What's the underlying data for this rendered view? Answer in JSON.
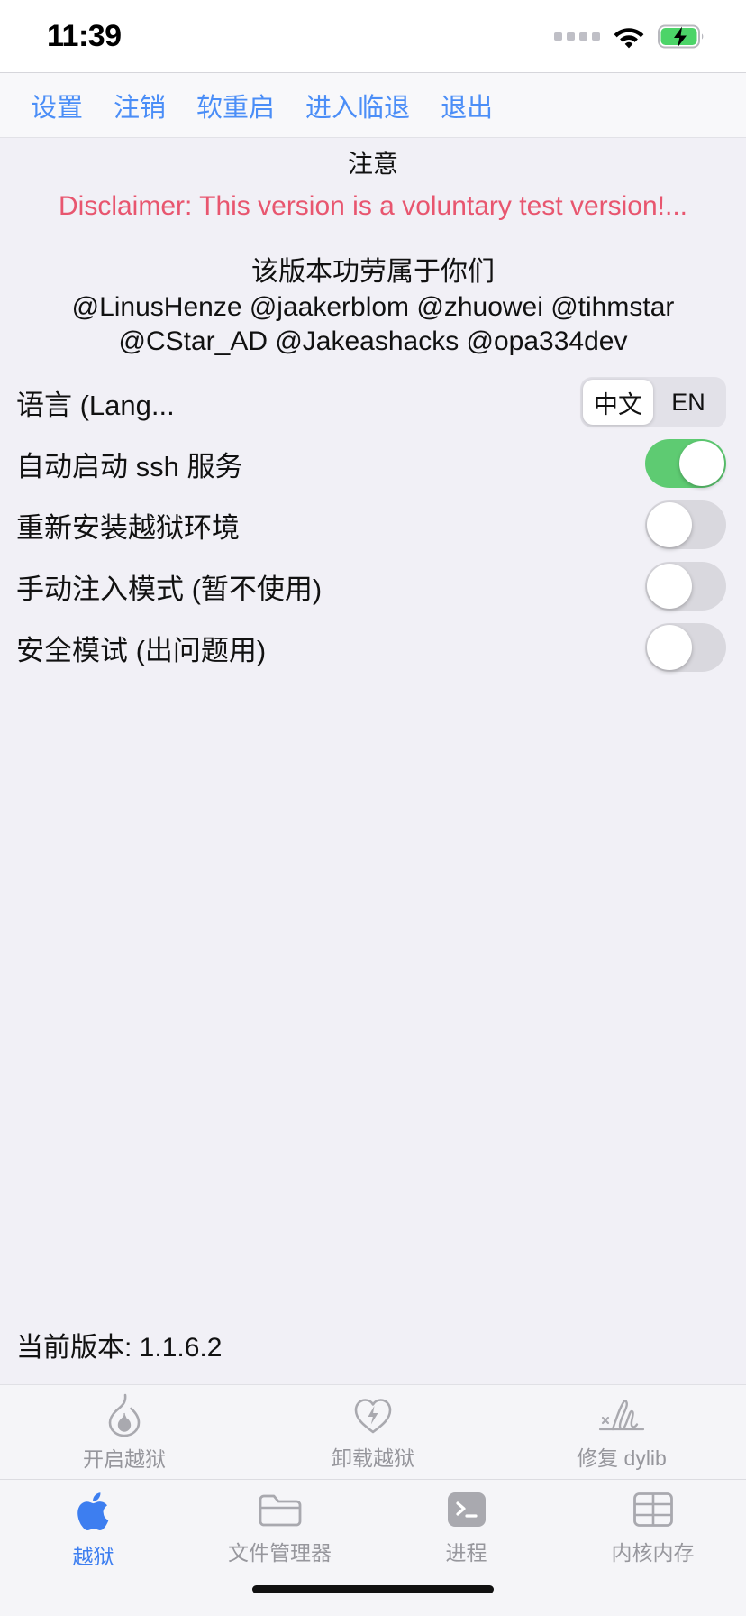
{
  "status_bar": {
    "time": "11:39",
    "signal_icon": "signal-dots-icon",
    "wifi_icon": "wifi-icon",
    "battery_icon": "battery-charging-icon"
  },
  "nav_buttons": [
    {
      "label": "设置",
      "name": "settings-button"
    },
    {
      "label": "注销",
      "name": "logout-button"
    },
    {
      "label": "软重启",
      "name": "soft-restart-button"
    },
    {
      "label": "进入临退",
      "name": "enter-temp-exit-button"
    },
    {
      "label": "退出",
      "name": "exit-button"
    }
  ],
  "notice": {
    "title": "注意",
    "disclaimer": "Disclaimer: This version is a voluntary test version!..."
  },
  "credits": {
    "title": "该版本功劳属于你们",
    "line1": "@LinusHenze @jaakerblom @zhuowei @tihmstar",
    "line2": "@CStar_AD @Jakeashacks @opa334dev"
  },
  "settings": {
    "language_row": {
      "label": "语言 (Lang...",
      "options": [
        "中文",
        "EN"
      ],
      "selected": "中文"
    },
    "toggles": [
      {
        "label": "自动启动 ssh 服务",
        "on": true,
        "name": "auto-start-ssh-toggle"
      },
      {
        "label": "重新安装越狱环境",
        "on": false,
        "name": "reinstall-jailbreak-env-toggle"
      },
      {
        "label": "手动注入模式 (暂不使用)",
        "on": false,
        "name": "manual-inject-mode-toggle"
      },
      {
        "label": "安全模试 (出问题用)",
        "on": false,
        "name": "safe-mode-toggle"
      }
    ]
  },
  "version_text": "当前版本: 1.1.6.2",
  "actions": [
    {
      "label": "开启越狱",
      "icon": "flame-icon",
      "name": "start-jailbreak-action"
    },
    {
      "label": "卸载越狱",
      "icon": "heart-bolt-icon",
      "name": "uninstall-jailbreak-action"
    },
    {
      "label": "修复 dylib",
      "icon": "signature-icon",
      "name": "repair-dylib-action"
    }
  ],
  "tabs": [
    {
      "label": "越狱",
      "icon": "apple-icon",
      "active": true,
      "name": "tab-jailbreak"
    },
    {
      "label": "文件管理器",
      "icon": "folder-icon",
      "active": false,
      "name": "tab-file-manager"
    },
    {
      "label": "进程",
      "icon": "terminal-icon",
      "active": false,
      "name": "tab-processes"
    },
    {
      "label": "内核内存",
      "icon": "grid-icon",
      "active": false,
      "name": "tab-kernel-memory"
    }
  ],
  "colors": {
    "accent_blue": "#4b8ef7",
    "tab_active_blue": "#3d7ef0",
    "disclaimer_red": "#e8566f",
    "toggle_on_green": "#5ecb72",
    "background": "#f1f0f6"
  }
}
